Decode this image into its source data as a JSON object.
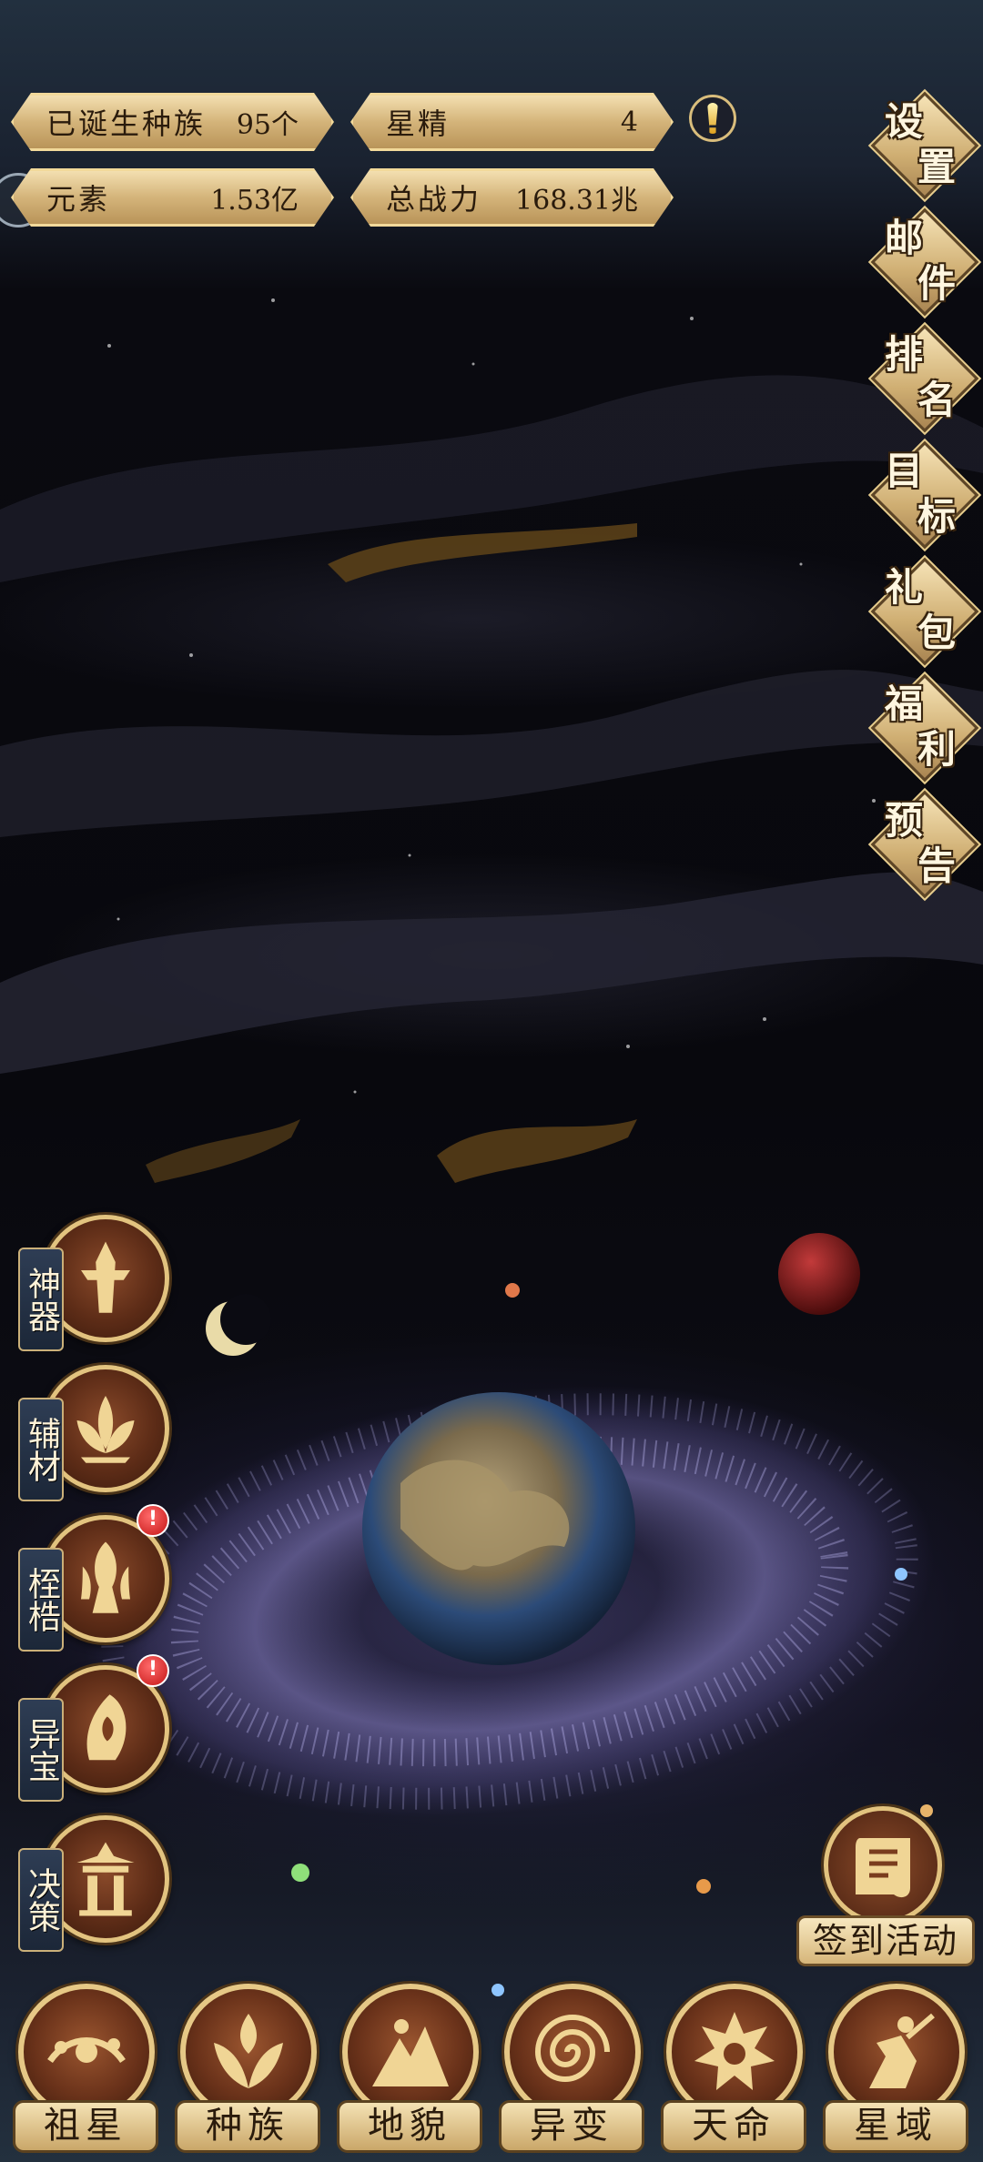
{
  "stats": {
    "species_label": "已诞生种族",
    "species_value": "95个",
    "essence_label": "星精",
    "essence_value": "4",
    "element_label": "元素",
    "element_value": "1.53亿",
    "power_label": "总战力",
    "power_value": "168.31兆"
  },
  "right_menu": [
    {
      "c1": "设",
      "c2": "置"
    },
    {
      "c1": "邮",
      "c2": "件"
    },
    {
      "c1": "排",
      "c2": "名"
    },
    {
      "c1": "目",
      "c2": "标"
    },
    {
      "c1": "礼",
      "c2": "包"
    },
    {
      "c1": "福",
      "c2": "利"
    },
    {
      "c1": "预",
      "c2": "告"
    }
  ],
  "left_menu": [
    {
      "label": "神器",
      "badge": ""
    },
    {
      "label": "辅材",
      "badge": ""
    },
    {
      "label": "桎梏",
      "badge": "!"
    },
    {
      "label": "异宝",
      "badge": "!"
    },
    {
      "label": "决策",
      "badge": ""
    }
  ],
  "signin": {
    "label": "签到活动"
  },
  "bottom_nav": [
    {
      "label": "祖星"
    },
    {
      "label": "种族"
    },
    {
      "label": "地貌"
    },
    {
      "label": "异变"
    },
    {
      "label": "天命"
    },
    {
      "label": "星域"
    }
  ],
  "colors": {
    "gold": "#e2c37f",
    "panel": "#d4b47a",
    "badge_red": "#c41515"
  }
}
